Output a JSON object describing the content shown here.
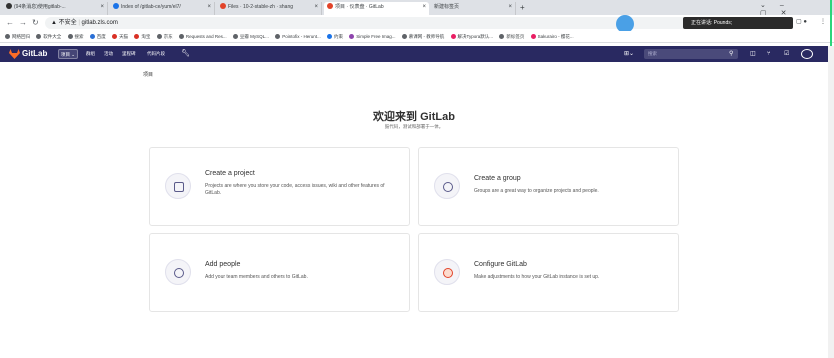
{
  "browser": {
    "tabs": [
      {
        "label": "(94条消息)使用gitlab-..."
      },
      {
        "label": "Index of /gitlab-ce/yum/el7/"
      },
      {
        "label": "Files · 10-2-stable-zh · shang"
      },
      {
        "label": "项目 · 仪表盘 · GitLab"
      },
      {
        "label": "新建标签页"
      }
    ],
    "url_secure": "不安全",
    "url": "gitlab.zls.com",
    "bookmarks": [
      "网络回归",
      "软件大全",
      "搜索",
      "百度",
      "天猫",
      "淘宝",
      "京东",
      "Requests and Res...",
      "豆瓣 MySQL...",
      "Pointofix - Herunt...",
      "约束",
      "Simple Free Imag...",
      "慕课网 - 教师导航",
      "解决Typora默认...",
      "新标签页",
      "Sakurairo - 樱花..."
    ],
    "side_label": "正在讲话: Pounds;"
  },
  "gitlab": {
    "logo": "GitLab",
    "nav": [
      "项目",
      "群组",
      "活动",
      "里程碑",
      "代码片段"
    ],
    "search_placeholder": "搜索",
    "breadcrumb": "项目",
    "welcome_title": "欢迎来到 GitLab",
    "welcome_sub": "鼓代码，测试和部署于一体。",
    "cards": [
      {
        "title": "Create a project",
        "desc": "Projects are where you store your code, access issues, wiki and other features of GitLab."
      },
      {
        "title": "Create a group",
        "desc": "Groups are a great way to organize projects and people."
      },
      {
        "title": "Add people",
        "desc": "Add your team members and others to GitLab."
      },
      {
        "title": "Configure GitLab",
        "desc": "Make adjustments to how your GitLab instance is set up."
      }
    ]
  }
}
